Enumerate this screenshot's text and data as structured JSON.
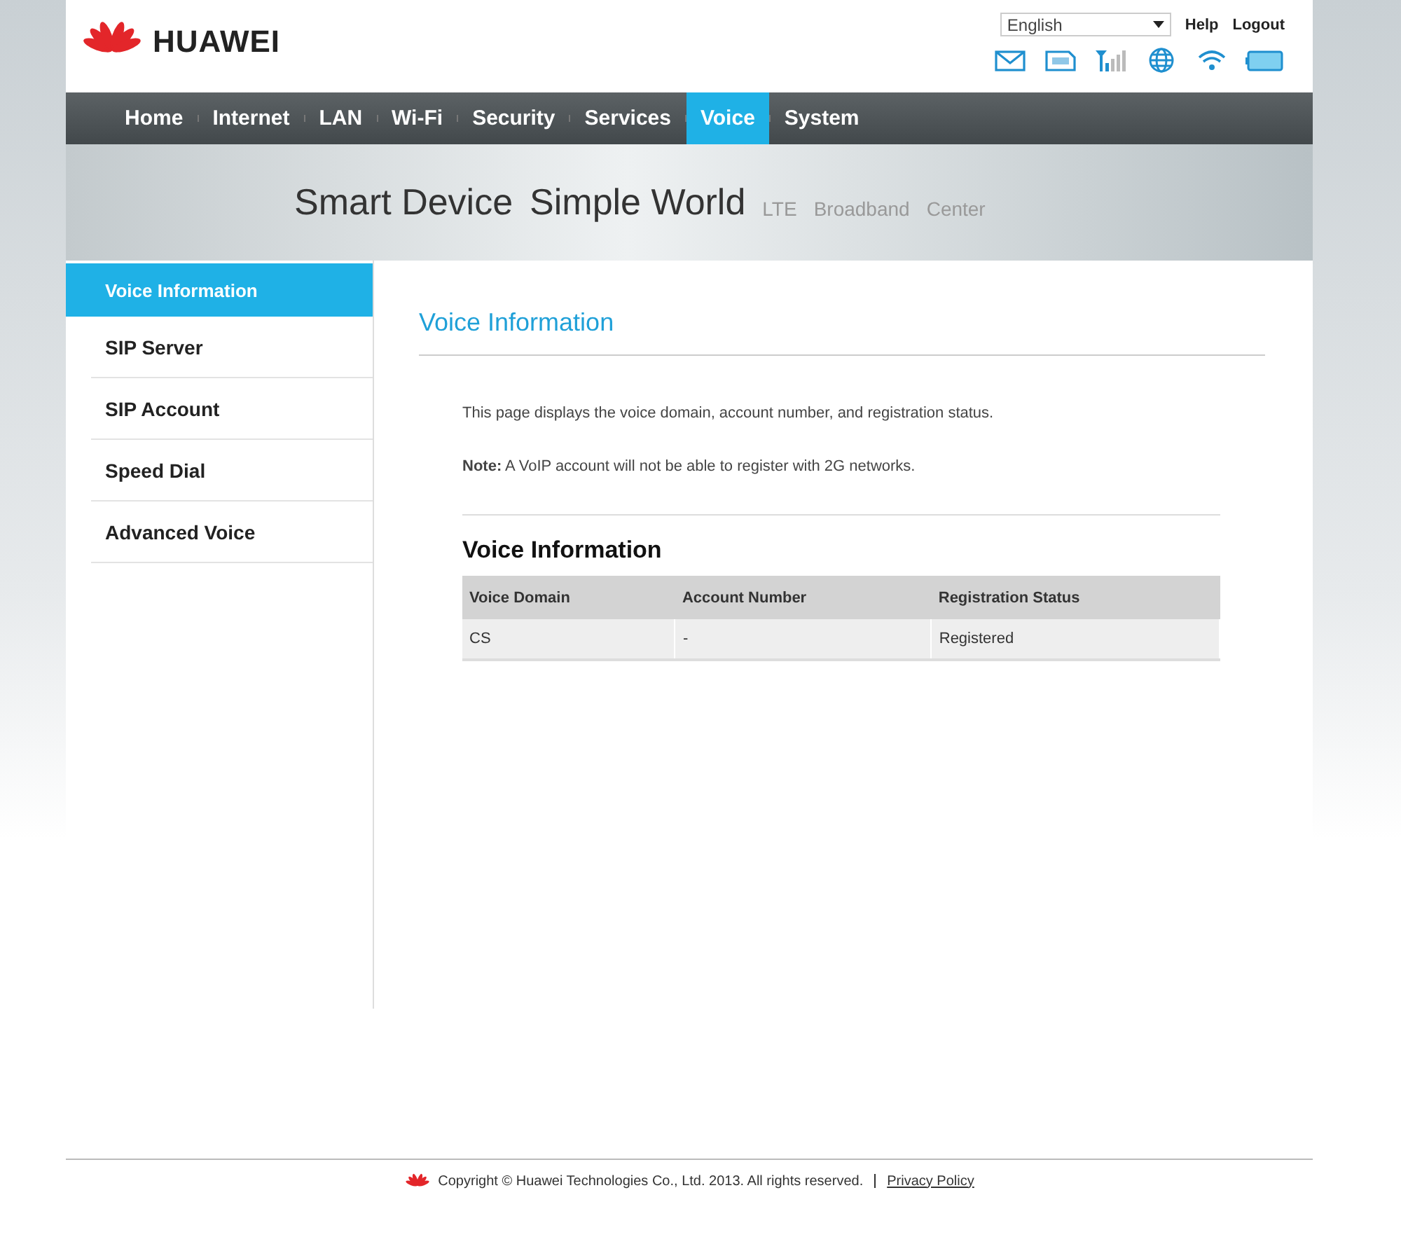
{
  "header": {
    "logo": "HUAWEI",
    "language": "English",
    "links": [
      "Help",
      "Logout"
    ]
  },
  "nav": [
    {
      "label": "Home",
      "selected": false
    },
    {
      "label": "Internet",
      "selected": false
    },
    {
      "label": "LAN",
      "selected": false
    },
    {
      "label": "Wi-Fi",
      "selected": false
    },
    {
      "label": "Security",
      "selected": false
    },
    {
      "label": "Services",
      "selected": false
    },
    {
      "label": "Voice",
      "selected": true
    },
    {
      "label": "System",
      "selected": false
    }
  ],
  "banner": {
    "slogan": [
      "Smart Device",
      "Simple World"
    ],
    "tagline": [
      "LTE",
      "Broadband",
      "Center"
    ]
  },
  "sidebar": [
    {
      "label": "Voice Information",
      "selected": true
    },
    {
      "label": "SIP Server",
      "selected": false
    },
    {
      "label": "SIP Account",
      "selected": false
    },
    {
      "label": "Speed Dial",
      "selected": false
    },
    {
      "label": "Advanced Voice",
      "selected": false
    }
  ],
  "page": {
    "title": "Voice Information",
    "description": "This page displays the voice domain, account number, and registration status.",
    "note": "**Note:** A VoIP account will not be able to register with 2G networks."
  },
  "section": {
    "title": "Voice Information",
    "columns": [
      "Voice Domain",
      "Account Number",
      "Registration Status"
    ],
    "rows": [
      [
        "CS",
        "-",
        "Registered"
      ]
    ]
  },
  "footer": {
    "copyright": "Copyright © Huawei Technologies Co., Ltd. 2013. All rights reserved.",
    "link": "Privacy Policy"
  }
}
